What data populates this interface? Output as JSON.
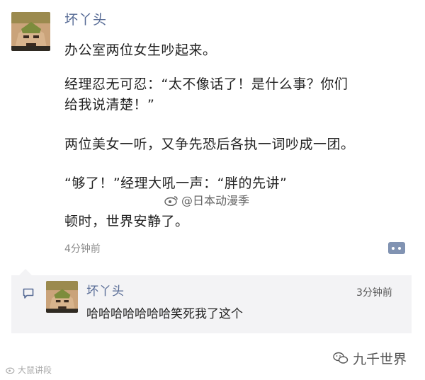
{
  "post": {
    "nickname": "坏丫头",
    "lines": [
      "办公室两位女生吵起来。",
      "经理忍无可忍：“太不像话了！是什么事？你们",
      "给我说清楚！”",
      "两位美女一听，又争先恐后各执一词吵成一团。",
      "“够了！”经理大吼一声：“胖的先讲”",
      "顿时，世界安静了。"
    ],
    "time": "4分钟前",
    "comment_icon": "comment-dots-icon"
  },
  "overlay_watermark": "@日本动漫季",
  "comment": {
    "nickname": "坏丫头",
    "time": "3分钟前",
    "text": "哈哈哈哈哈哈哈笑死我了这个",
    "icon": "speech-bubble-icon"
  },
  "footer": {
    "left_watermark": "大鼠讲段",
    "right_watermark": "九千世界"
  },
  "colors": {
    "nickname": "#576b95",
    "comment_panel": "#f3f3f5",
    "comment_button": "#8193b2"
  }
}
